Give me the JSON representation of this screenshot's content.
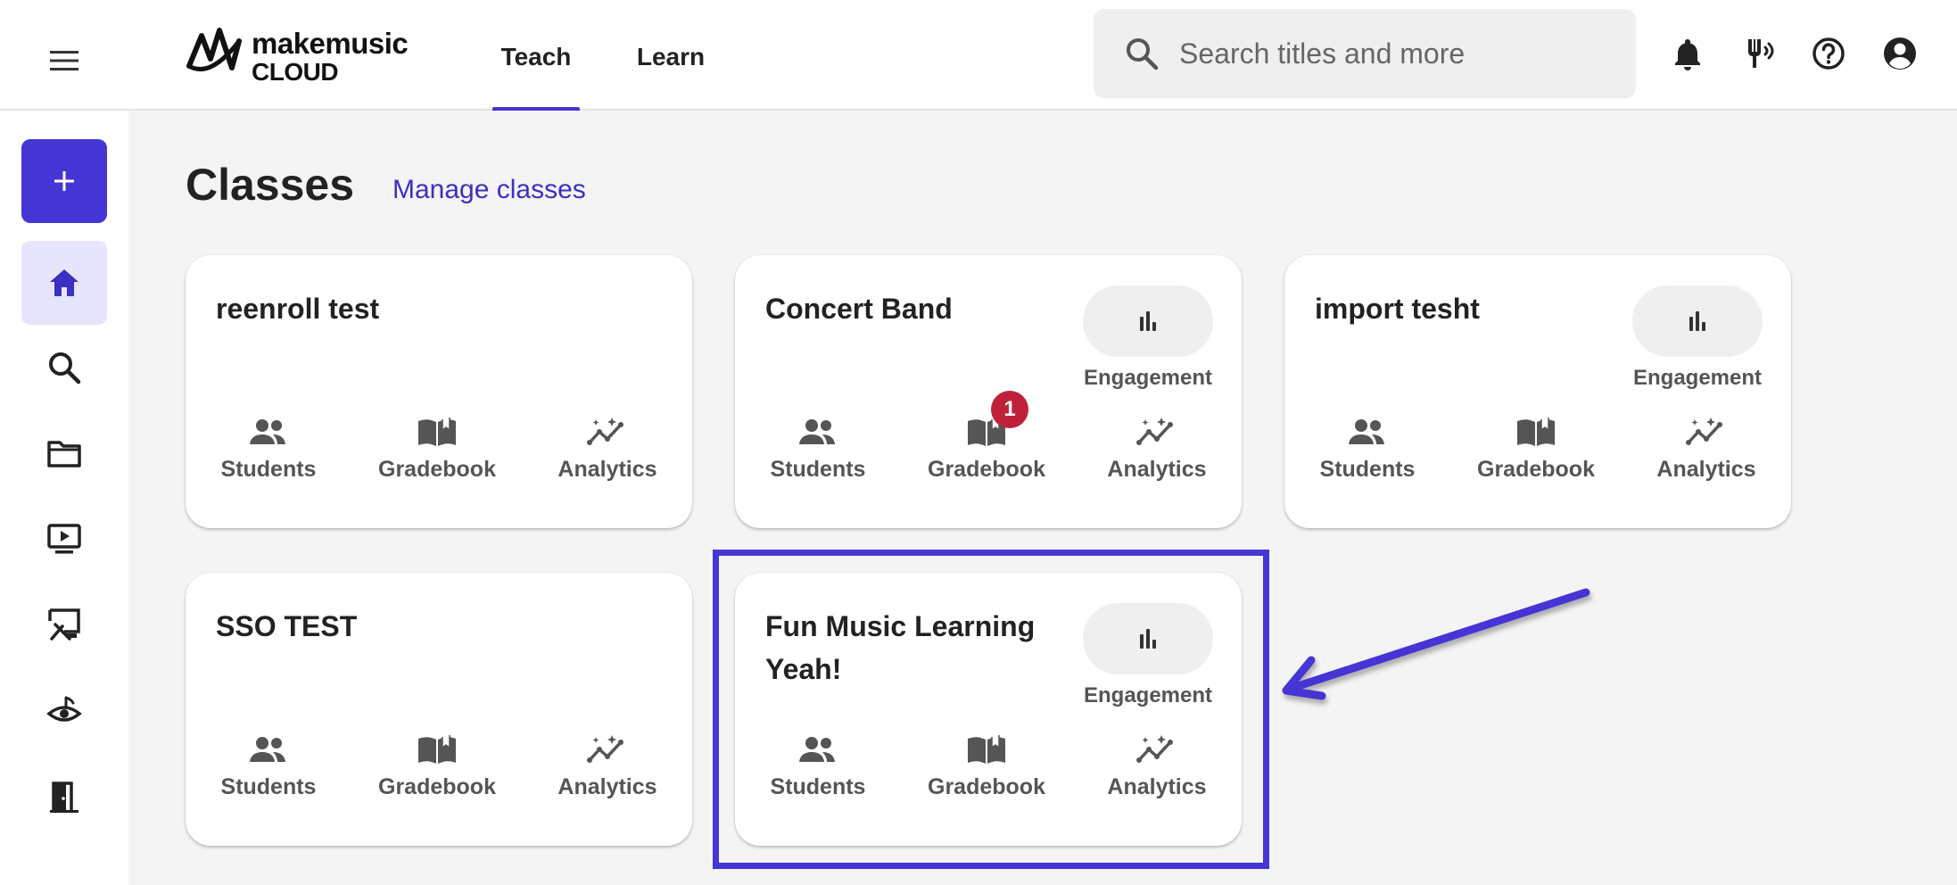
{
  "header": {
    "logo": {
      "line1": "makemusic",
      "line2": "CLOUD"
    },
    "tabs": [
      {
        "label": "Teach",
        "active": true
      },
      {
        "label": "Learn",
        "active": false
      }
    ],
    "search": {
      "placeholder": "Search titles and more",
      "value": ""
    },
    "icons": [
      "bell-icon",
      "tuning-fork-icon",
      "help-icon",
      "account-icon"
    ]
  },
  "sidebar": {
    "items": [
      {
        "icon": "plus-icon",
        "name": "create"
      },
      {
        "icon": "home-icon",
        "name": "home",
        "active": true
      },
      {
        "icon": "search-icon",
        "name": "search"
      },
      {
        "icon": "folder-icon",
        "name": "files"
      },
      {
        "icon": "play-screen-icon",
        "name": "media"
      },
      {
        "icon": "easel-icon",
        "name": "teach"
      },
      {
        "icon": "ear-eye-icon",
        "name": "sight-reading"
      },
      {
        "icon": "door-icon",
        "name": "exit"
      }
    ]
  },
  "main": {
    "title": "Classes",
    "manage_link": "Manage classes",
    "cards": [
      {
        "title": "reenroll test",
        "engagement": false,
        "engagement_label": "",
        "gradebook_badge": ""
      },
      {
        "title": "Concert Band",
        "engagement": true,
        "engagement_label": "Engagement",
        "gradebook_badge": "1"
      },
      {
        "title": "import tesht",
        "engagement": true,
        "engagement_label": "Engagement",
        "gradebook_badge": ""
      },
      {
        "title": "SSO TEST",
        "engagement": false,
        "engagement_label": "",
        "gradebook_badge": ""
      },
      {
        "title": "Fun Music Learning Yeah!",
        "engagement": true,
        "engagement_label": "Engagement",
        "gradebook_badge": "",
        "highlighted": true
      }
    ],
    "actions": {
      "students": "Students",
      "gradebook": "Gradebook",
      "analytics": "Analytics"
    }
  },
  "colors": {
    "accent": "#4436d4",
    "badge": "#c0213a",
    "link": "#3a30c2"
  }
}
